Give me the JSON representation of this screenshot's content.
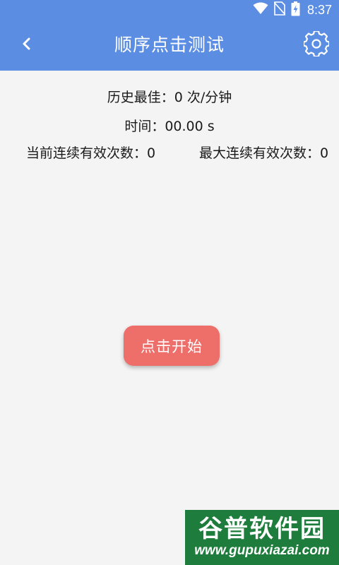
{
  "status_bar": {
    "time": "8:37",
    "icons": [
      "wifi-icon",
      "no-sim-icon",
      "battery-charging-icon"
    ]
  },
  "header": {
    "title": "顺序点击测试",
    "back_icon": "chevron-left-icon",
    "settings_icon": "gear-icon",
    "background_color": "#5b8ee3"
  },
  "stats": {
    "best": "历史最佳：0 次/分钟",
    "time": "时间：00.00 s",
    "current_streak": "当前连续有效次数：0",
    "max_streak": "最大连续有效次数：0"
  },
  "start_button": {
    "label": "点击开始",
    "color": "#ee6e69"
  },
  "watermark": {
    "name": "谷普软件园",
    "url": "www.gupuxiazai.com",
    "color": "#1e7d3c"
  }
}
